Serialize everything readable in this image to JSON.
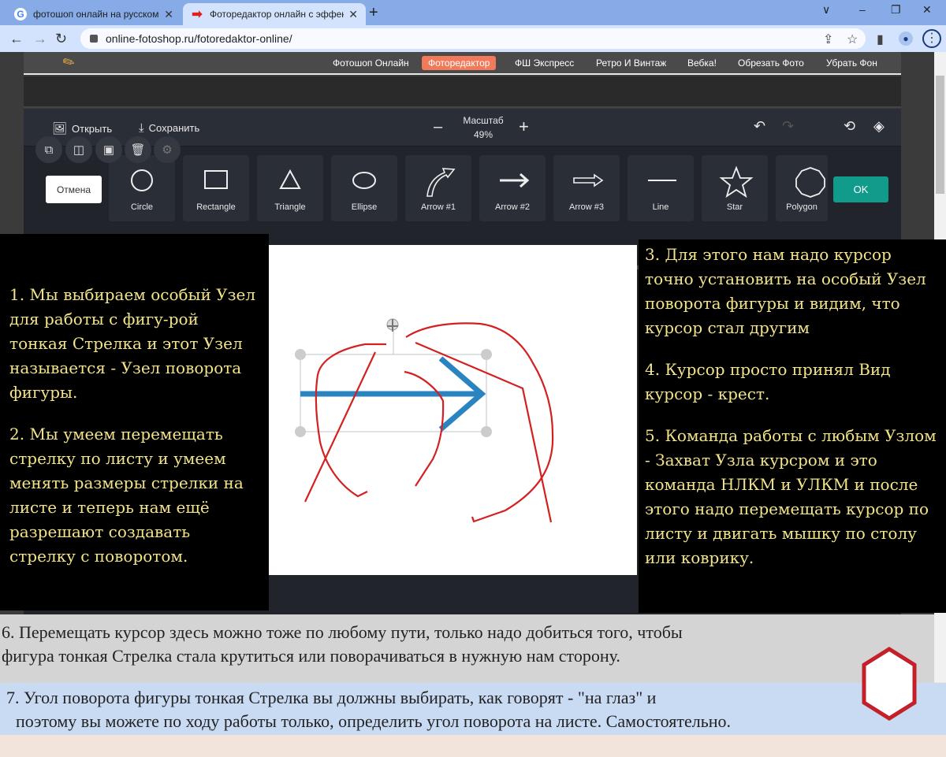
{
  "browser": {
    "tabs": [
      {
        "title": "фотошоп онлайн на русском - Г",
        "favicon": "google-icon",
        "active": false
      },
      {
        "title": "Фоторедактор онлайн с эффект",
        "favicon": "red-arrow-icon",
        "active": true
      }
    ],
    "new_tab": "+",
    "url": "online-fotoshop.ru/fotoredaktor-online/",
    "window_controls": [
      "∨",
      "–",
      "❐",
      "✕"
    ]
  },
  "site": {
    "nav": [
      {
        "label": "Фотошоп Онлайн",
        "active": false
      },
      {
        "label": "Фоторедактор",
        "active": true
      },
      {
        "label": "ФШ Экспресс",
        "active": false
      },
      {
        "label": "Ретро И Винтаж",
        "active": false
      },
      {
        "label": "Вебка!",
        "active": false
      },
      {
        "label": "Обрезать Фото",
        "active": false
      },
      {
        "label": "Убрать Фон",
        "active": false
      }
    ],
    "accent_color": "#f07a5a"
  },
  "editor": {
    "toolbar": {
      "open_label": "Открыть",
      "save_label": "Сохранить",
      "zoom_title": "Масштаб",
      "zoom_value": "49%",
      "zoom_minus": "–",
      "zoom_plus": "+"
    },
    "cancel_label": "Отмена",
    "ok_label": "OK",
    "ok_color": "#109b8b",
    "shapes": [
      {
        "label": "Circle",
        "icon": "circle-icon"
      },
      {
        "label": "Rectangle",
        "icon": "rectangle-icon"
      },
      {
        "label": "Triangle",
        "icon": "triangle-icon"
      },
      {
        "label": "Ellipse",
        "icon": "ellipse-icon"
      },
      {
        "label": "Arrow #1",
        "icon": "curved-arrow-icon"
      },
      {
        "label": "Arrow #2",
        "icon": "arrow-icon"
      },
      {
        "label": "Arrow #3",
        "icon": "double-line-arrow-icon"
      },
      {
        "label": "Line",
        "icon": "line-icon"
      },
      {
        "label": "Star",
        "icon": "star-icon"
      },
      {
        "label": "Polygon",
        "icon": "polygon-icon"
      }
    ],
    "context_actions": [
      "duplicate",
      "flip",
      "bring-forward",
      "delete",
      "settings"
    ],
    "canvas": {
      "arrow_color": "#2a84c0",
      "annotation_color": "#d42020"
    }
  },
  "notes": {
    "left": [
      "1. Мы выбираем особый Узел для работы с фигу-рой тонкая Стрелка и этот Узел называется - Узел поворота фигуры.",
      "2. Мы умеем перемещать стрелку по листу и умеем менять размеры стрелки на листе и теперь нам ещё разрешают создавать стрелку с поворотом."
    ],
    "right": [
      "3. Для этого нам надо курсор точно установить на особый Узел поворота фигуры и видим, что курсор стал другим",
      "4. Курсор просто принял Вид курсор - крест.",
      "5. Команда работы с любым Узлом - Захват Узла курсром и это команда НЛКМ и УЛКМ и после этого надо перемещать курсор по листу и двигать мышку по столу или коврику."
    ],
    "text_color": "#f3e48a"
  },
  "bottom": {
    "note6_line1": "6. Перемещать курсор здесь можно тоже по любому пути, только надо добиться того, чтобы",
    "note6_line2": "фигура тонкая Стрелка стала крутиться или поворачиваться в нужную нам сторону.",
    "note7_line1": "7. Угол поворота фигуры тонкая Стрелка вы должны выбирать, как говорят - \"на глаз\" и",
    "note7_line2": "поэтому вы можете по ходу работы только, определить угол поворота на листе. Самостоятельно."
  }
}
